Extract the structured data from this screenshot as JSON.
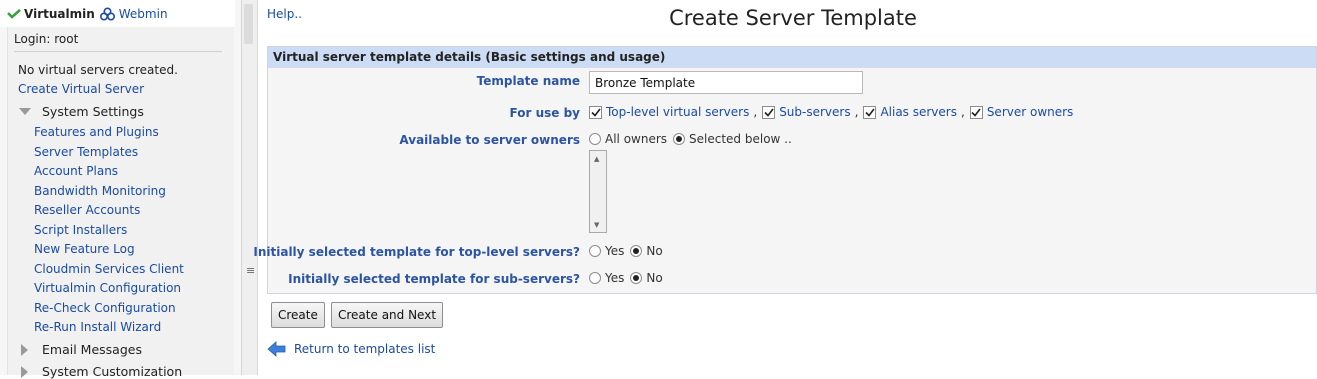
{
  "sidebar": {
    "brand_virtualmin": "Virtualmin",
    "brand_webmin": "Webmin",
    "login": "Login: root",
    "status": "No virtual servers created.",
    "create_link": "Create Virtual Server",
    "categories": [
      {
        "label": "System Settings",
        "expanded": true
      },
      {
        "label": "Email Messages",
        "expanded": false
      },
      {
        "label": "System Customization",
        "expanded": false
      }
    ],
    "system_settings_items": [
      "Features and Plugins",
      "Server Templates",
      "Account Plans",
      "Bandwidth Monitoring",
      "Reseller Accounts",
      "Script Installers",
      "New Feature Log",
      "Cloudmin Services Client",
      "Virtualmin Configuration",
      "Re-Check Configuration",
      "Re-Run Install Wizard"
    ]
  },
  "main": {
    "help": "Help..",
    "title": "Create Server Template",
    "panel_title": "Virtual server template details (Basic settings and usage)",
    "template_name": {
      "label": "Template name",
      "value": "Bronze Template"
    },
    "for_use_by": {
      "label": "For use by",
      "options": [
        {
          "label": "Top-level virtual servers",
          "checked": true
        },
        {
          "label": "Sub-servers",
          "checked": true
        },
        {
          "label": "Alias servers",
          "checked": true
        },
        {
          "label": "Server owners",
          "checked": true
        }
      ],
      "separator": ","
    },
    "available_to_owners": {
      "label": "Available to server owners",
      "options": [
        {
          "label": "All owners",
          "selected": false
        },
        {
          "label": "Selected below ..",
          "selected": true
        }
      ]
    },
    "initial_top_level": {
      "label": "Initially selected template for top-level servers?",
      "options": [
        {
          "label": "Yes",
          "selected": false
        },
        {
          "label": "No",
          "selected": true
        }
      ]
    },
    "initial_sub_servers": {
      "label": "Initially selected template for sub-servers?",
      "options": [
        {
          "label": "Yes",
          "selected": false
        },
        {
          "label": "No",
          "selected": true
        }
      ]
    },
    "buttons": {
      "create": "Create",
      "create_next": "Create and Next"
    },
    "return_link": "Return to templates list"
  },
  "colors": {
    "link": "#1a4ba3",
    "label": "#2c54a3",
    "panel_header": "#cddcf5",
    "brand_green": "#3aa03a"
  }
}
